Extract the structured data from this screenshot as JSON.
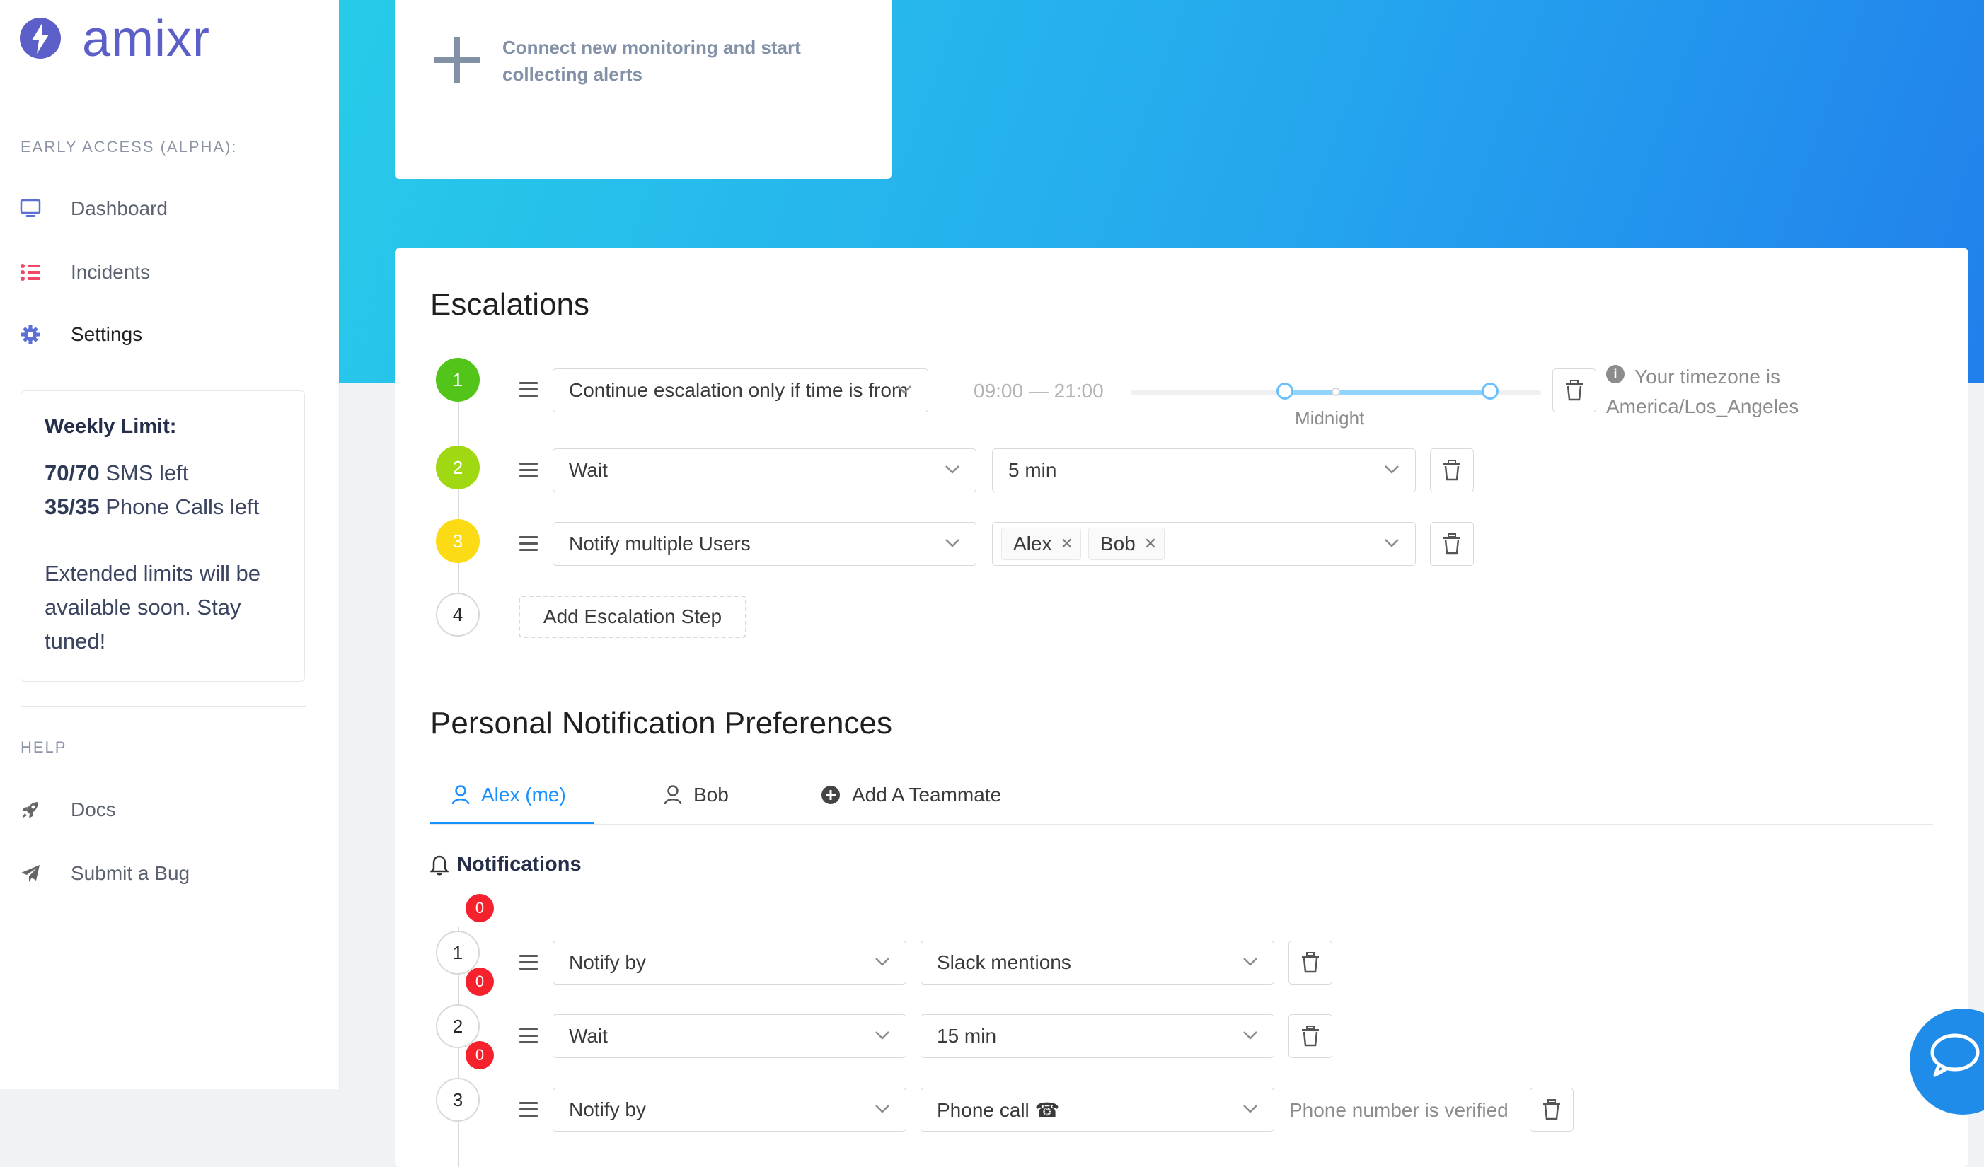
{
  "brand": {
    "name": "amixr"
  },
  "sidebar": {
    "section_early": "EARLY ACCESS (ALPHA):",
    "nav": [
      {
        "label": "Dashboard",
        "icon": "monitor-icon"
      },
      {
        "label": "Incidents",
        "icon": "list-icon"
      },
      {
        "label": "Settings",
        "icon": "gear-icon"
      }
    ],
    "limit": {
      "title": "Weekly Limit:",
      "sms_count": "70/70",
      "sms_label": " SMS left",
      "calls_count": "35/35",
      "calls_label": " Phone Calls left",
      "note": "Extended limits will be available soon. Stay tuned!"
    },
    "section_help": "HELP",
    "help": [
      {
        "label": "Docs",
        "icon": "rocket-icon"
      },
      {
        "label": "Submit a Bug",
        "icon": "paper-plane-icon"
      }
    ]
  },
  "connect": {
    "text": "Connect new monitoring and start collecting alerts"
  },
  "escalations": {
    "title": "Escalations",
    "steps": [
      {
        "number": "1",
        "color": "#52c41a",
        "action": "Continue escalation only if time is from",
        "time_range": "09:00 — 21:00",
        "slider_label": "Midnight",
        "timezone_line1": "Your timezone is",
        "timezone_line2": "America/Los_Angeles",
        "range_start": 0.375,
        "range_end": 0.875
      },
      {
        "number": "2",
        "color": "#a0d911",
        "action": "Wait",
        "value": "5 min"
      },
      {
        "number": "3",
        "color": "#fadb14",
        "action": "Notify multiple Users",
        "users": [
          "Alex",
          "Bob"
        ]
      },
      {
        "number": "4",
        "add_label": "Add Escalation Step"
      }
    ]
  },
  "preferences": {
    "title": "Personal Notification Preferences",
    "tabs": [
      {
        "label": "Alex (me)",
        "icon": "user-icon",
        "active": true
      },
      {
        "label": "Bob",
        "icon": "user-icon",
        "active": false
      },
      {
        "label": "Add A Teammate",
        "icon": "plus-circle-icon",
        "active": false
      }
    ],
    "notifications_title": "Notifications",
    "steps": [
      {
        "number": "1",
        "badge": "0",
        "action": "Notify by",
        "value": "Slack mentions"
      },
      {
        "number": "2",
        "badge": "0",
        "action": "Wait",
        "value": "15 min"
      },
      {
        "number": "3",
        "badge": "0",
        "action": "Notify by",
        "value": "Phone call ☎",
        "status": "Phone number is verified"
      }
    ]
  },
  "colors": {
    "accent": "#1890ff",
    "brand": "#5b5fc7",
    "badge": "#f5222d"
  }
}
